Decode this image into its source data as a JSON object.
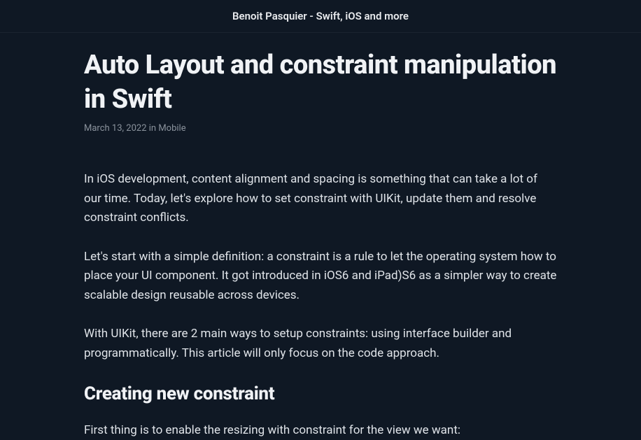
{
  "header": {
    "site_title": "Benoit Pasquier - Swift, iOS and more"
  },
  "article": {
    "title": "Auto Layout and constraint manipulation in Swift",
    "date": "March 13, 2022",
    "meta_separator": " in ",
    "category": "Mobile",
    "paragraphs": [
      "In iOS development, content alignment and spacing is something that can take a lot of our time. Today, let's explore how to set constraint with UIKit, update them and resolve constraint conflicts.",
      "Let's start with a simple definition: a constraint is a rule to let the operating system how to place your UI component. It got introduced in iOS6 and iPad)S6 as a simpler way to create scalable design reusable across devices.",
      "With UIKit, there are 2 main ways to setup constraints: using interface builder and programmatically. This article will only focus on the code approach."
    ],
    "heading1": "Creating new constraint",
    "paragraph_after_heading": "First thing is to enable the resizing with constraint for the view we want:"
  }
}
